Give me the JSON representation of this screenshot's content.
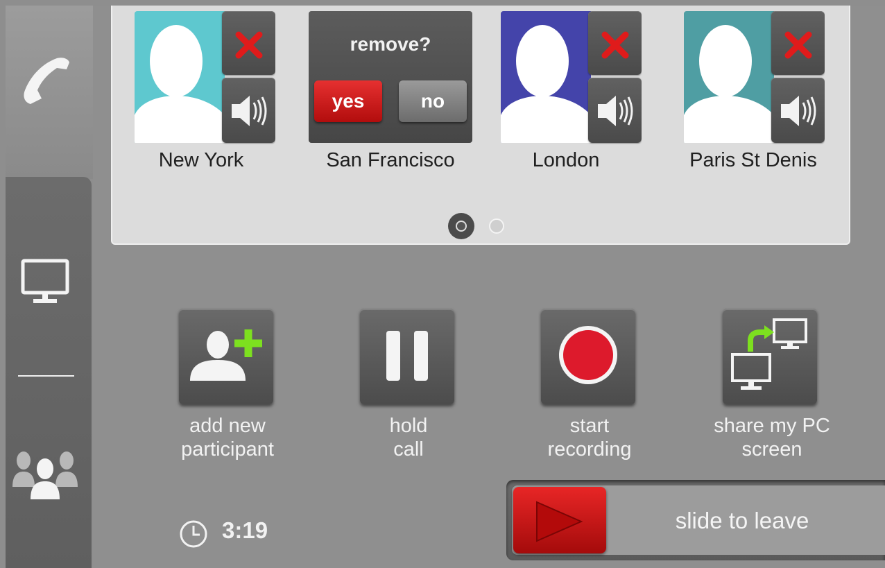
{
  "participants": [
    {
      "name": "New York",
      "avatar_color": "#5ec8cf"
    },
    {
      "name": "San Francisco",
      "avatar_color": "#5ec8cf"
    },
    {
      "name": "London",
      "avatar_color": "#4444aa"
    },
    {
      "name": "Paris St Denis",
      "avatar_color": "#4f9ea3"
    }
  ],
  "remove_confirm": {
    "prompt": "remove?",
    "yes": "yes",
    "no": "no"
  },
  "pagination": {
    "current": 1,
    "total": 2
  },
  "actions": {
    "add_participant": {
      "line1": "add new",
      "line2": "participant"
    },
    "hold_call": {
      "line1": "hold",
      "line2": "call"
    },
    "start_recording": {
      "line1": "start",
      "line2": "recording"
    },
    "share_screen": {
      "line1": "share my PC",
      "line2": "screen"
    }
  },
  "timer": {
    "elapsed": "3:19"
  },
  "slider": {
    "label": "slide to leave"
  },
  "colors": {
    "danger_red": "#e01b1b",
    "record_red": "#dd1a2c",
    "add_green": "#7de01f"
  },
  "icons": [
    "phone-icon",
    "monitor-icon",
    "group-icon",
    "remove-icon",
    "speaker-icon",
    "add-user-icon",
    "pause-icon",
    "record-icon",
    "share-screen-icon",
    "clock-icon",
    "play-arrow-icon"
  ]
}
